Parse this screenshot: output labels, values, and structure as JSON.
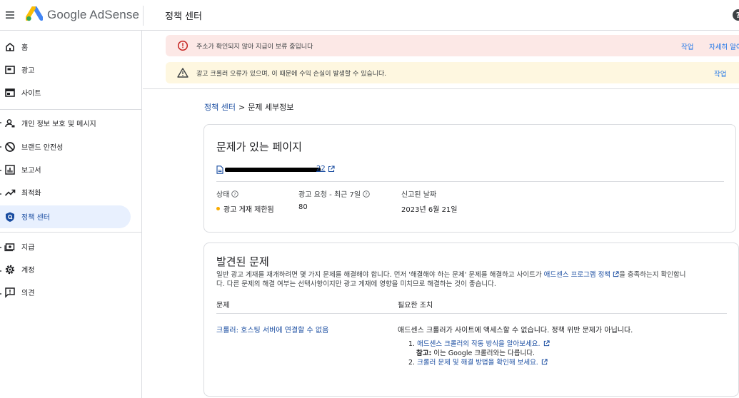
{
  "header": {
    "brand": "Google AdSense",
    "page_title": "정책 센터"
  },
  "sidebar": {
    "items": [
      {
        "label": "홈",
        "icon": "home-icon"
      },
      {
        "label": "광고",
        "icon": "ads-icon"
      },
      {
        "label": "사이트",
        "icon": "sites-icon"
      },
      {
        "label": "개인 정보 보호 및 메시지",
        "icon": "privacy-messaging-icon"
      },
      {
        "label": "브랜드 안전성",
        "icon": "brand-safety-icon"
      },
      {
        "label": "보고서",
        "icon": "reports-icon"
      },
      {
        "label": "최적화",
        "icon": "optimization-icon"
      },
      {
        "label": "정책 센터",
        "icon": "policy-center-icon",
        "active": true
      },
      {
        "label": "지급",
        "icon": "payments-icon"
      },
      {
        "label": "계정",
        "icon": "account-gear-icon"
      },
      {
        "label": "의견",
        "icon": "feedback-icon"
      }
    ]
  },
  "alerts": {
    "error": {
      "text": "주소가 확인되지 않아 지급이 보류 중입니다",
      "action": "작업",
      "more": "자세히 알아"
    },
    "warning": {
      "text": "광고 크롤러 오류가 있으며, 이 때문에 수익 손실이 발생할 수 있습니다.",
      "action": "작업"
    }
  },
  "breadcrumb": {
    "parent": "정책 센터",
    "separator": ">",
    "current": "문제 세부정보"
  },
  "page_card": {
    "title": "문제가 있는 페이지",
    "url_tail": "22",
    "columns": [
      {
        "header": "상태",
        "value": "광고 게재 제한됨",
        "status_color": "#f9ab00"
      },
      {
        "header": "광고 요청 - 최근 7일",
        "value": "80"
      },
      {
        "header": "신고된 날짜",
        "value": "2023년 6월 21일"
      }
    ]
  },
  "issues_card": {
    "title": "발견된 문제",
    "description_before": "일반 광고 게재를 재개하려면 몇 가지 문제를 해결해야 합니다. 먼저 '해결해야 하는 문제' 문제를 해결하고 사이트가 ",
    "description_link": "애드센스 프로그램 정책",
    "description_after_line1": "을 충족하는지 확인합니",
    "description_line2": "다. 다른 문제의 해결 여부는 선택사항이지만 광고 게재에 영향을 미치므로 해결하는 것이 좋습니다.",
    "col_issue": "문제",
    "col_action": "필요한 조치",
    "issue_link": "크롤러: 호스팅 서버에 연결할 수 없음",
    "action_text": "애드센스 크롤러가 사이트에 액세스할 수 없습니다. 정책 위반 문제가 아닙니다.",
    "step1_num": "1.",
    "step1_link": "애드센스 크롤러의 작동 방식을 알아보세요.",
    "note_label": "참고:",
    "note_text": " 이는 Google 크롤러와는 다릅니다.",
    "step2_num": "2.",
    "step2_link": "크롤러 문제 및 해결 방법을 확인해 보세요."
  },
  "colors": {
    "link": "#1a4da1",
    "error_bg": "#fce8e6",
    "warning_bg": "#fef7e0",
    "active_nav_bg": "#e8f0fe"
  }
}
